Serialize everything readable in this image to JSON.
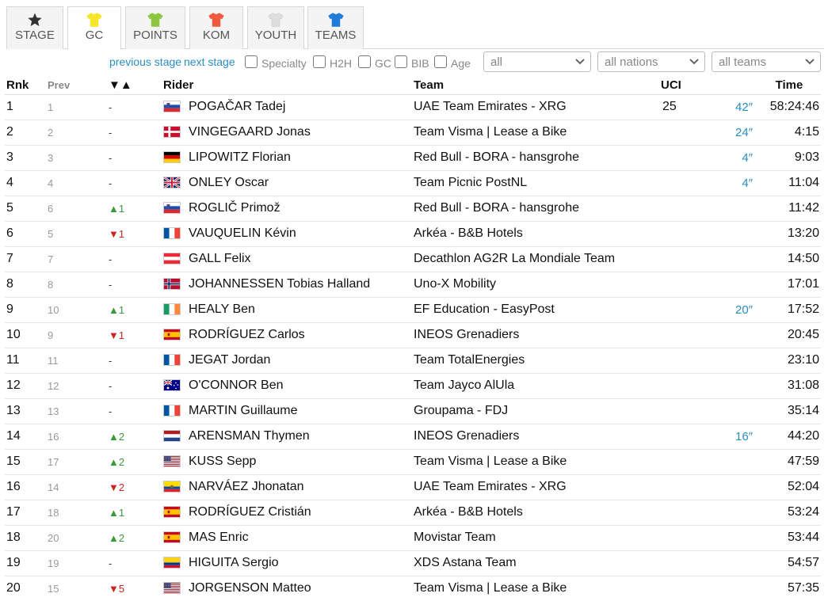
{
  "tabs": [
    {
      "label": "STAGE",
      "icon": "star-icon",
      "color": "#333333",
      "active": false
    },
    {
      "label": "GC",
      "icon": "yellow-jersey-icon",
      "color": "#f5e62a",
      "active": true
    },
    {
      "label": "POINTS",
      "icon": "green-jersey-icon",
      "color": "#8cc63f",
      "active": false
    },
    {
      "label": "KOM",
      "icon": "polka-jersey-icon",
      "color": "#f05a3c",
      "active": false
    },
    {
      "label": "YOUTH",
      "icon": "white-jersey-icon",
      "color": "#dddddd",
      "active": false
    },
    {
      "label": "TEAMS",
      "icon": "team-jersey-icon",
      "color": "#1f7ad9",
      "active": false
    }
  ],
  "controls": {
    "previous_stage": "previous stage",
    "next_stage": "next stage",
    "checkboxes": [
      "Specialty",
      "H2H",
      "GC",
      "BIB",
      "Age"
    ],
    "select_all": "all",
    "select_nations": "all nations",
    "select_teams": "all teams"
  },
  "table": {
    "headers": {
      "rnk": "Rnk",
      "prev": "Prev",
      "change": "▼▲",
      "rider": "Rider",
      "team": "Team",
      "uci": "UCI",
      "time": "Time"
    },
    "rows": [
      {
        "rnk": "1",
        "prev": "1",
        "change": "-",
        "dir": "same",
        "flag": "si",
        "rider": "POGAČAR Tadej",
        "team": "UAE Team Emirates - XRG",
        "uci": "25",
        "bonus": "42″",
        "time": "58:24:46"
      },
      {
        "rnk": "2",
        "prev": "2",
        "change": "-",
        "dir": "same",
        "flag": "dk",
        "rider": "VINGEGAARD Jonas",
        "team": "Team Visma | Lease a Bike",
        "uci": "",
        "bonus": "24″",
        "time": "4:15"
      },
      {
        "rnk": "3",
        "prev": "3",
        "change": "-",
        "dir": "same",
        "flag": "de",
        "rider": "LIPOWITZ Florian",
        "team": "Red Bull - BORA - hansgrohe",
        "uci": "",
        "bonus": "4″",
        "time": "9:03"
      },
      {
        "rnk": "4",
        "prev": "4",
        "change": "-",
        "dir": "same",
        "flag": "gb",
        "rider": "ONLEY Oscar",
        "team": "Team Picnic PostNL",
        "uci": "",
        "bonus": "4″",
        "time": "11:04"
      },
      {
        "rnk": "5",
        "prev": "6",
        "change": "▲1",
        "dir": "up",
        "flag": "si",
        "rider": "ROGLIČ Primož",
        "team": "Red Bull - BORA - hansgrohe",
        "uci": "",
        "bonus": "",
        "time": "11:42"
      },
      {
        "rnk": "6",
        "prev": "5",
        "change": "▼1",
        "dir": "down",
        "flag": "fr",
        "rider": "VAUQUELIN Kévin",
        "team": "Arkéa - B&B Hotels",
        "uci": "",
        "bonus": "",
        "time": "13:20"
      },
      {
        "rnk": "7",
        "prev": "7",
        "change": "-",
        "dir": "same",
        "flag": "at",
        "rider": "GALL Felix",
        "team": "Decathlon AG2R La Mondiale Team",
        "uci": "",
        "bonus": "",
        "time": "14:50"
      },
      {
        "rnk": "8",
        "prev": "8",
        "change": "-",
        "dir": "same",
        "flag": "no",
        "rider": "JOHANNESSEN Tobias Halland",
        "team": "Uno-X Mobility",
        "uci": "",
        "bonus": "",
        "time": "17:01"
      },
      {
        "rnk": "9",
        "prev": "10",
        "change": "▲1",
        "dir": "up",
        "flag": "ie",
        "rider": "HEALY Ben",
        "team": "EF Education - EasyPost",
        "uci": "",
        "bonus": "20″",
        "time": "17:52"
      },
      {
        "rnk": "10",
        "prev": "9",
        "change": "▼1",
        "dir": "down",
        "flag": "es",
        "rider": "RODRÍGUEZ Carlos",
        "team": "INEOS Grenadiers",
        "uci": "",
        "bonus": "",
        "time": "20:45"
      },
      {
        "rnk": "11",
        "prev": "11",
        "change": "-",
        "dir": "same",
        "flag": "fr",
        "rider": "JEGAT Jordan",
        "team": "Team TotalEnergies",
        "uci": "",
        "bonus": "",
        "time": "23:10"
      },
      {
        "rnk": "12",
        "prev": "12",
        "change": "-",
        "dir": "same",
        "flag": "au",
        "rider": "O'CONNOR Ben",
        "team": "Team Jayco AlUla",
        "uci": "",
        "bonus": "",
        "time": "31:08"
      },
      {
        "rnk": "13",
        "prev": "13",
        "change": "-",
        "dir": "same",
        "flag": "fr",
        "rider": "MARTIN Guillaume",
        "team": "Groupama - FDJ",
        "uci": "",
        "bonus": "",
        "time": "35:14"
      },
      {
        "rnk": "14",
        "prev": "16",
        "change": "▲2",
        "dir": "up",
        "flag": "nl",
        "rider": "ARENSMAN Thymen",
        "team": "INEOS Grenadiers",
        "uci": "",
        "bonus": "16″",
        "time": "44:20"
      },
      {
        "rnk": "15",
        "prev": "17",
        "change": "▲2",
        "dir": "up",
        "flag": "us",
        "rider": "KUSS Sepp",
        "team": "Team Visma | Lease a Bike",
        "uci": "",
        "bonus": "",
        "time": "47:59"
      },
      {
        "rnk": "16",
        "prev": "14",
        "change": "▼2",
        "dir": "down",
        "flag": "ec",
        "rider": "NARVÁEZ Jhonatan",
        "team": "UAE Team Emirates - XRG",
        "uci": "",
        "bonus": "",
        "time": "52:04"
      },
      {
        "rnk": "17",
        "prev": "18",
        "change": "▲1",
        "dir": "up",
        "flag": "es",
        "rider": "RODRÍGUEZ Cristián",
        "team": "Arkéa - B&B Hotels",
        "uci": "",
        "bonus": "",
        "time": "53:24"
      },
      {
        "rnk": "18",
        "prev": "20",
        "change": "▲2",
        "dir": "up",
        "flag": "es",
        "rider": "MAS Enric",
        "team": "Movistar Team",
        "uci": "",
        "bonus": "",
        "time": "53:44"
      },
      {
        "rnk": "19",
        "prev": "19",
        "change": "-",
        "dir": "same",
        "flag": "co",
        "rider": "HIGUITA Sergio",
        "team": "XDS Astana Team",
        "uci": "",
        "bonus": "",
        "time": "54:57"
      },
      {
        "rnk": "20",
        "prev": "15",
        "change": "▼5",
        "dir": "down",
        "flag": "us",
        "rider": "JORGENSON Matteo",
        "team": "Team Visma | Lease a Bike",
        "uci": "",
        "bonus": "",
        "time": "57:35"
      }
    ]
  }
}
